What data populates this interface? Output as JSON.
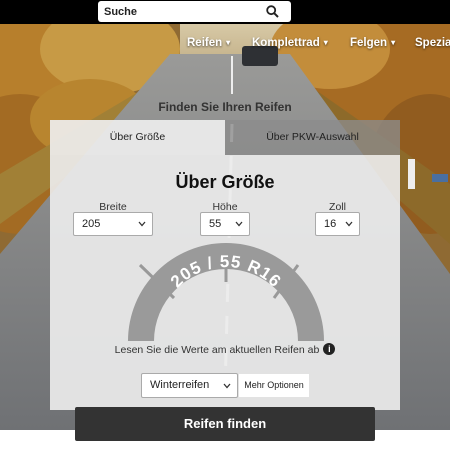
{
  "search": {
    "placeholder": "Suche"
  },
  "nav": {
    "items": [
      {
        "label": "Reifen"
      },
      {
        "label": "Komplettrad"
      },
      {
        "label": "Felgen"
      },
      {
        "label": "Spezia"
      }
    ],
    "caret": "▾"
  },
  "headline": "Finden Sie Ihren Reifen",
  "tabs": {
    "active": "Über Größe",
    "inactive": "Über PKW-Auswahl"
  },
  "form": {
    "title": "Über Größe",
    "width": {
      "label": "Breite",
      "value": "205"
    },
    "height": {
      "label": "Höhe",
      "value": "55"
    },
    "rim": {
      "label": "Zoll",
      "value": "16"
    },
    "tire_marking": "205 / 55 R16",
    "hint": "Lesen Sie die Werte am aktuellen Reifen ab",
    "info_glyph": "i",
    "season": {
      "value": "Winterreifen"
    },
    "more_options": "Mehr Optionen",
    "submit": "Reifen finden"
  },
  "colors": {
    "button": "#333333",
    "panel": "#ececec",
    "topbar": "#000000"
  },
  "icons": [
    "search-icon",
    "chevron-down-icon",
    "info-icon"
  ]
}
